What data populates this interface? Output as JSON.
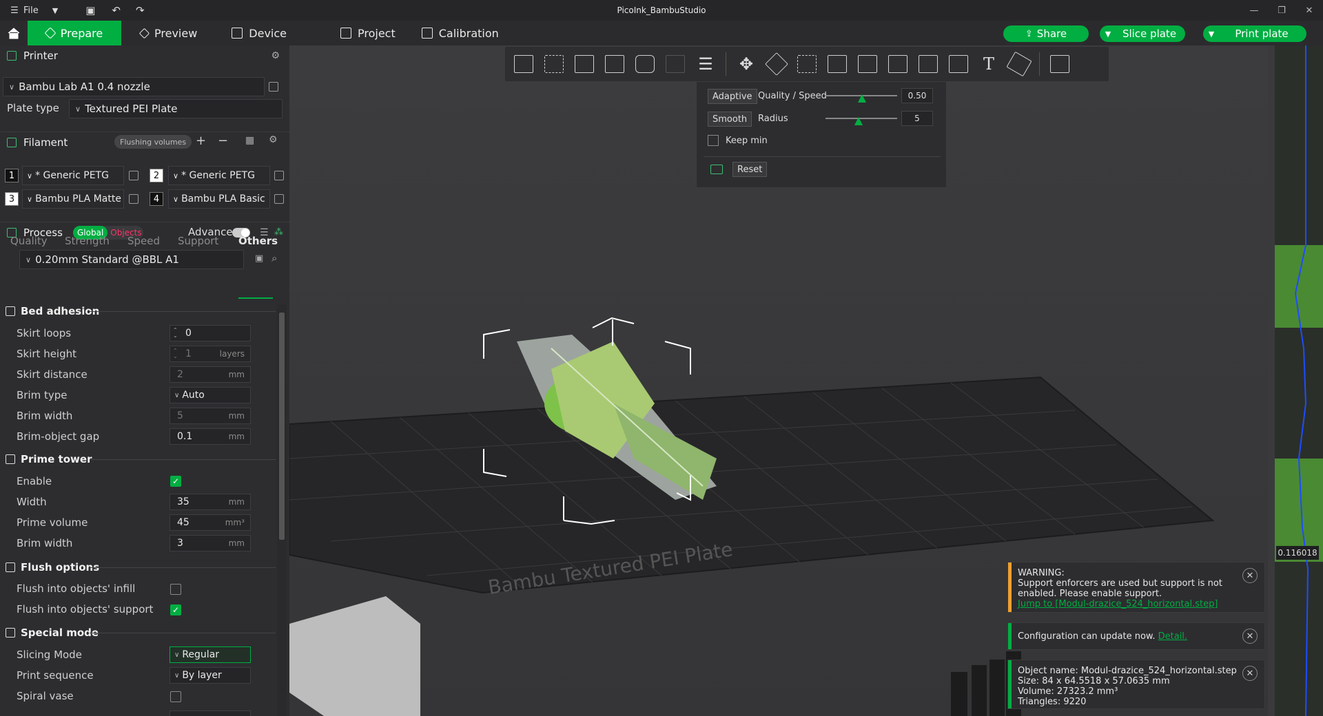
{
  "window": {
    "title": "PicoInk_BambuStudio",
    "file_label": "File"
  },
  "tabs": [
    {
      "label": "Prepare"
    },
    {
      "label": "Preview"
    },
    {
      "label": "Device"
    },
    {
      "label": "Project"
    },
    {
      "label": "Calibration"
    }
  ],
  "actions": {
    "share": "Share",
    "slice": "Slice plate",
    "print": "Print plate"
  },
  "printer": {
    "header": "Printer",
    "name": "Bambu Lab A1 0.4 nozzle",
    "plate_label": "Plate type",
    "plate_value": "Textured PEI Plate"
  },
  "filament": {
    "header": "Filament",
    "flush": "Flushing volumes",
    "items": [
      {
        "num": "1",
        "name": "* Generic PETG",
        "color": "#111111"
      },
      {
        "num": "2",
        "name": "* Generic PETG",
        "color": "#ffffff"
      },
      {
        "num": "3",
        "name": "Bambu PLA Matte",
        "color": "#ffffff"
      },
      {
        "num": "4",
        "name": "Bambu PLA Basic",
        "color": "#111111"
      }
    ]
  },
  "process": {
    "header": "Process",
    "global": "Global",
    "objects": "Objects",
    "advance": "Advance",
    "preset": "0.20mm Standard @BBL A1"
  },
  "subtabs": [
    "Quality",
    "Strength",
    "Speed",
    "Support",
    "Others"
  ],
  "groups": {
    "bed_adhesion": "Bed adhesion",
    "prime_tower": "Prime tower",
    "flush_options": "Flush options",
    "special_mode": "Special mode"
  },
  "settings": {
    "skirt_loops": {
      "label": "Skirt loops",
      "value": "0"
    },
    "skirt_height": {
      "label": "Skirt height",
      "value": "1",
      "unit": "layers"
    },
    "skirt_distance": {
      "label": "Skirt distance",
      "value": "2",
      "unit": "mm"
    },
    "brim_type": {
      "label": "Brim type",
      "value": "Auto"
    },
    "brim_width": {
      "label": "Brim width",
      "value": "5",
      "unit": "mm"
    },
    "brim_gap": {
      "label": "Brim-object gap",
      "value": "0.1",
      "unit": "mm"
    },
    "pt_enable": {
      "label": "Enable",
      "checked": true
    },
    "pt_width": {
      "label": "Width",
      "value": "35",
      "unit": "mm"
    },
    "pt_volume": {
      "label": "Prime volume",
      "value": "45",
      "unit": "mm³"
    },
    "pt_brim": {
      "label": "Brim width",
      "value": "3",
      "unit": "mm"
    },
    "flush_infill": {
      "label": "Flush into objects' infill",
      "checked": false
    },
    "flush_support": {
      "label": "Flush into objects' support",
      "checked": true
    },
    "slicing_mode": {
      "label": "Slicing Mode",
      "value": "Regular"
    },
    "print_sequence": {
      "label": "Print sequence",
      "value": "By layer"
    },
    "spiral_vase": {
      "label": "Spiral vase",
      "checked": false
    }
  },
  "layer_panel": {
    "adaptive": "Adaptive",
    "quality_speed": "Quality / Speed",
    "quality_value": "0.50",
    "smooth": "Smooth",
    "radius": "Radius",
    "radius_value": "5",
    "keep_min": "Keep min",
    "reset": "Reset"
  },
  "plate_text": "Bambu Textured PEI Plate",
  "layer_height_readout": "0.116018",
  "notifications": {
    "warning_title": "WARNING:",
    "warning_body": "Support enforcers are used but support is not enabled. Please enable support.",
    "warning_link": "Jump to [Modul-drazice_524_horizontal.step]",
    "config_text": "Configuration can update now.",
    "config_link": "Detail.",
    "obj_name": "Object name: Modul-drazice_524_horizontal.step",
    "obj_size": "Size: 84 x 64.5518 x 57.0635 mm",
    "obj_volume": "Volume: 27323.2 mm³",
    "obj_triangles": "Triangles: 9220"
  },
  "colors": {
    "accent": "#00ae42",
    "warning": "#f0a030"
  }
}
